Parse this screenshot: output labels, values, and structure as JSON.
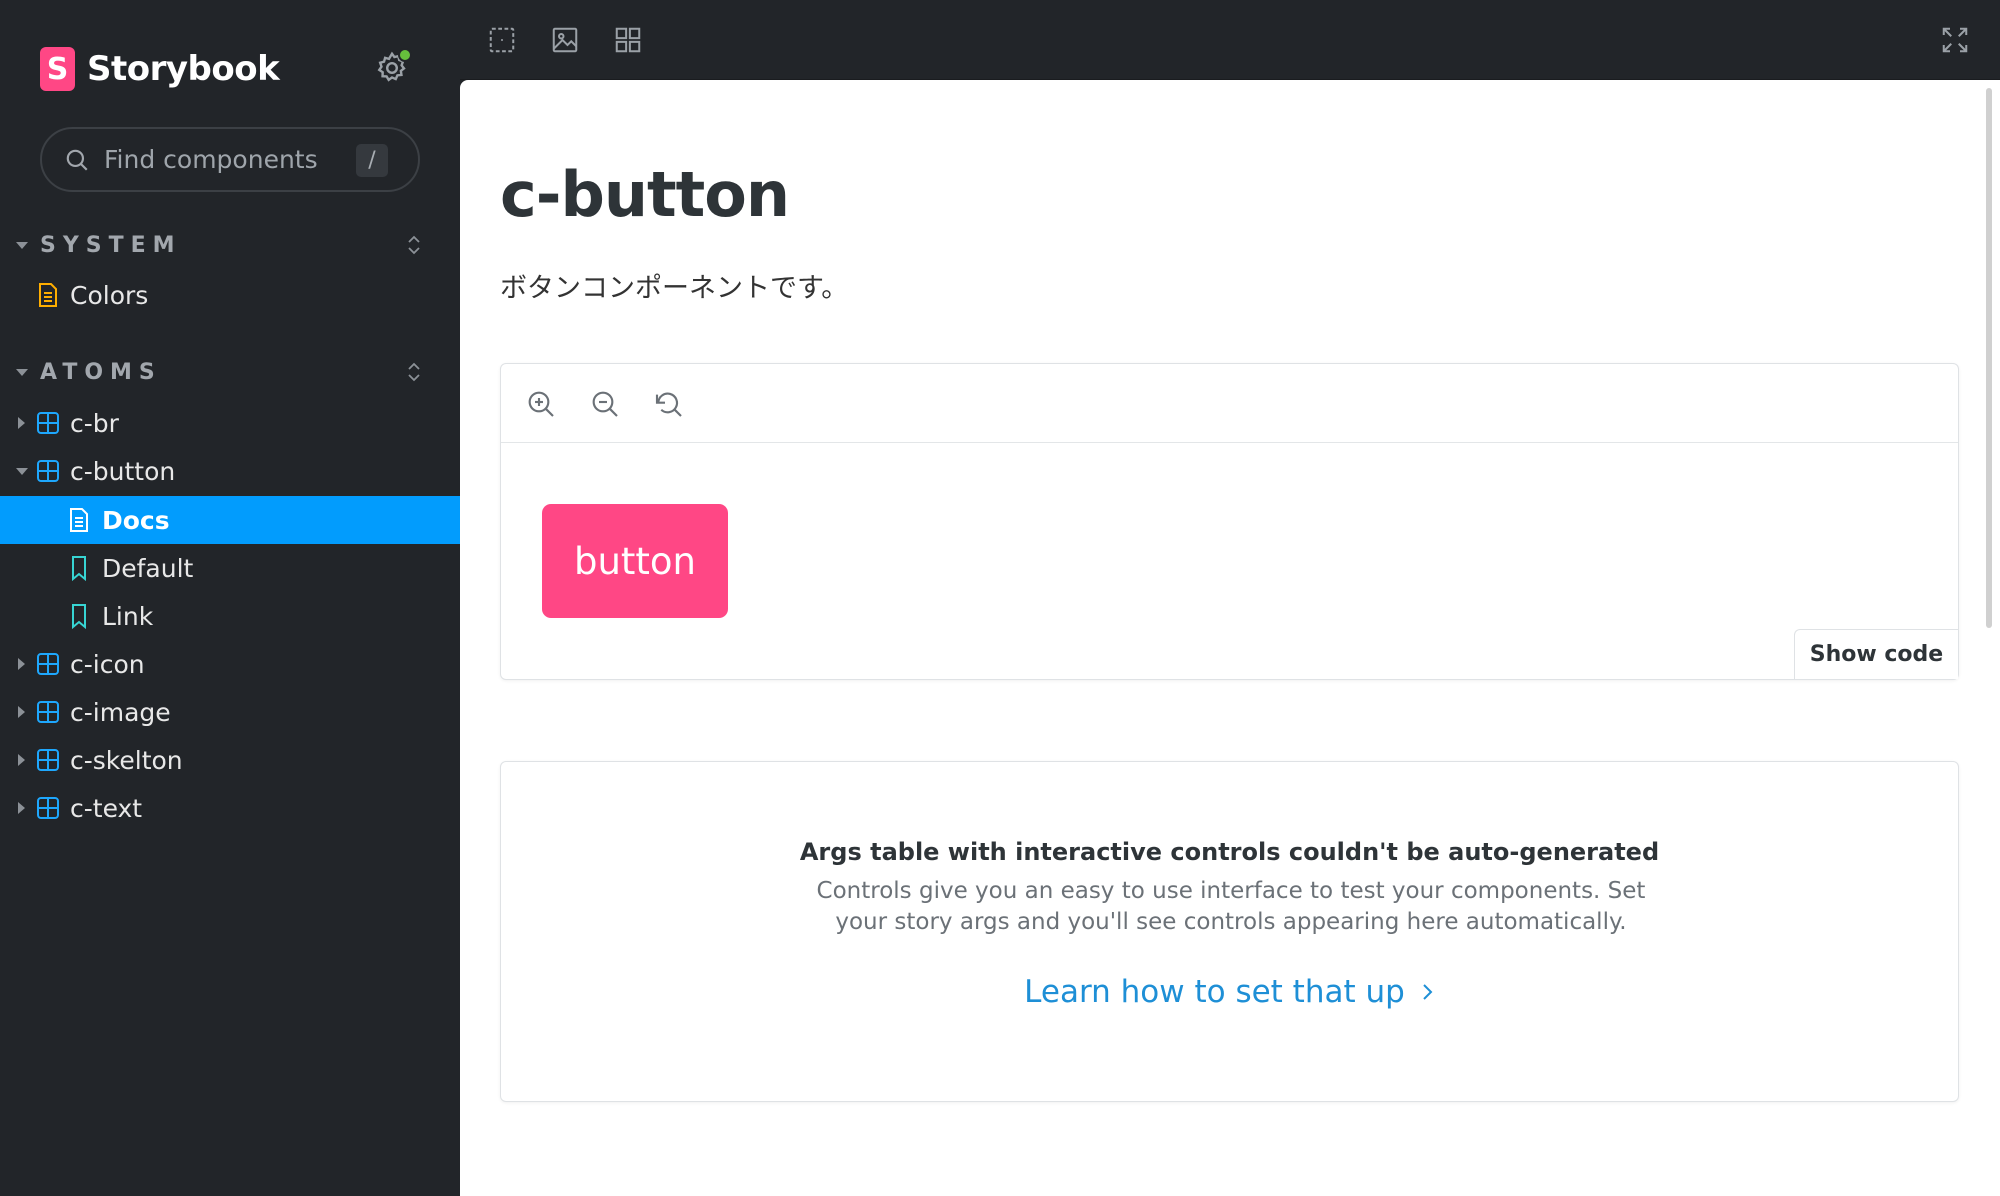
{
  "sidebar": {
    "brand": {
      "logo_letter": "S",
      "name": "Storybook",
      "color": "#ff4785"
    },
    "settings": {
      "icon": "gear-icon",
      "status_color": "#66bf3c"
    },
    "search": {
      "placeholder": "Find components",
      "shortcut": "/"
    },
    "sections": [
      {
        "label": "SYSTEM"
      },
      {
        "label": "ATOMS"
      }
    ],
    "system_items": [
      {
        "label": "Colors",
        "icon": "document-icon"
      }
    ],
    "atoms_items": [
      {
        "label": "c-br",
        "icon": "component-icon",
        "expanded": false
      },
      {
        "label": "c-button",
        "icon": "component-icon",
        "expanded": true
      },
      {
        "label": "Docs",
        "icon": "document-icon",
        "selected": true
      },
      {
        "label": "Default",
        "icon": "bookmark-icon"
      },
      {
        "label": "Link",
        "icon": "bookmark-icon"
      },
      {
        "label": "c-icon",
        "icon": "component-icon",
        "expanded": false
      },
      {
        "label": "c-image",
        "icon": "component-icon",
        "expanded": false
      },
      {
        "label": "c-skelton",
        "icon": "component-icon",
        "expanded": false
      },
      {
        "label": "c-text",
        "icon": "component-icon",
        "expanded": false
      }
    ],
    "accent_color": "#029cfd"
  },
  "toolbar": {
    "tools": [
      "outline-icon",
      "image-icon",
      "grid-icon"
    ],
    "fullscreen": "fullscreen-icon"
  },
  "doc": {
    "title": "c-button",
    "description": "ボタンコンポーネントです。",
    "preview": {
      "tools": [
        "zoom-in-icon",
        "zoom-out-icon",
        "reset-zoom-icon"
      ],
      "button_label": "button",
      "button_color": "#ff4785",
      "show_code": "Show code"
    },
    "args": {
      "title": "Args table with interactive controls couldn't be auto-generated",
      "description": "Controls give you an easy to use interface to test your components. Set your story args and you'll see controls appearing here automatically.",
      "link": "Learn how to set that up"
    }
  }
}
